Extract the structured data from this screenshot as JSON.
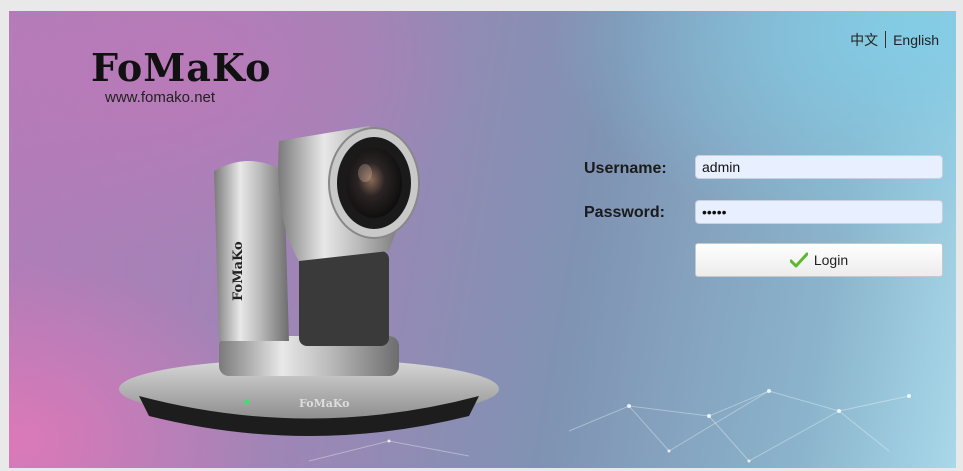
{
  "language": {
    "chinese": "中文",
    "english": "English"
  },
  "brand": {
    "name": "FoMaKo",
    "url": "www.fomako.net",
    "camera_label": "FoMaKo",
    "camera_side_label": "FoMaKo"
  },
  "login": {
    "username_label": "Username:",
    "username_value": "admin",
    "password_label": "Password:",
    "password_value": "•••••",
    "button_label": "Login"
  },
  "icons": {
    "login": "checkmark-icon"
  },
  "colors": {
    "field_bg": "#e8efff",
    "checkmark": "#5cb82e"
  }
}
